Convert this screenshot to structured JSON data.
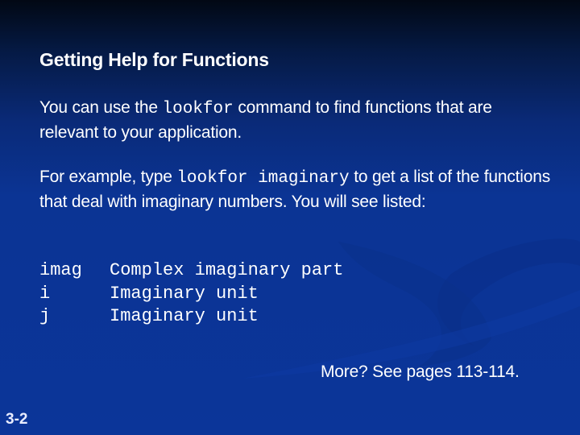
{
  "slide": {
    "title": "Getting Help for Functions",
    "paragraph1": {
      "before": "You can use the ",
      "code": "lookfor",
      "after": " command to find functions that are relevant to your application."
    },
    "paragraph2": {
      "before": "For example, type ",
      "code": "lookfor imaginary",
      "after": " to get a list of the functions that deal with imaginary numbers. You will see listed:"
    },
    "listing": [
      {
        "name": "imag",
        "description": "Complex imaginary part"
      },
      {
        "name": "i",
        "description": "Imaginary unit"
      },
      {
        "name": "j",
        "description": "Imaginary unit"
      }
    ],
    "more_note": "More? See pages 113-114.",
    "slide_number": "3-2"
  },
  "colors": {
    "background_top": "#020814",
    "background_main": "#0b3599",
    "text": "#ffffff"
  }
}
